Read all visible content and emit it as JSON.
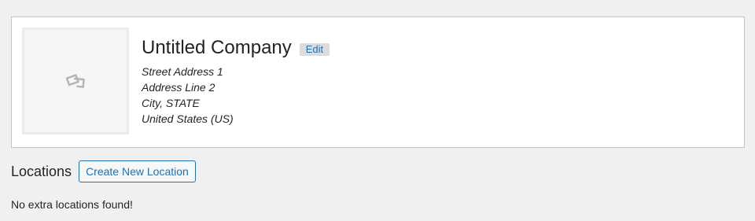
{
  "company": {
    "name": "Untitled Company",
    "edit_label": "Edit",
    "logo_icon": "image-placeholder-icon",
    "address": {
      "line1": "Street Address 1",
      "line2": "Address Line 2",
      "city_state": "City, STATE",
      "country": "United States (US)"
    }
  },
  "locations": {
    "title": "Locations",
    "create_button_label": "Create New Location",
    "empty_message": "No extra locations found!"
  },
  "colors": {
    "accent": "#2271b1",
    "background": "#f0f0f1",
    "card_border": "#c3c4c7",
    "badge_background": "#dcdcde"
  }
}
